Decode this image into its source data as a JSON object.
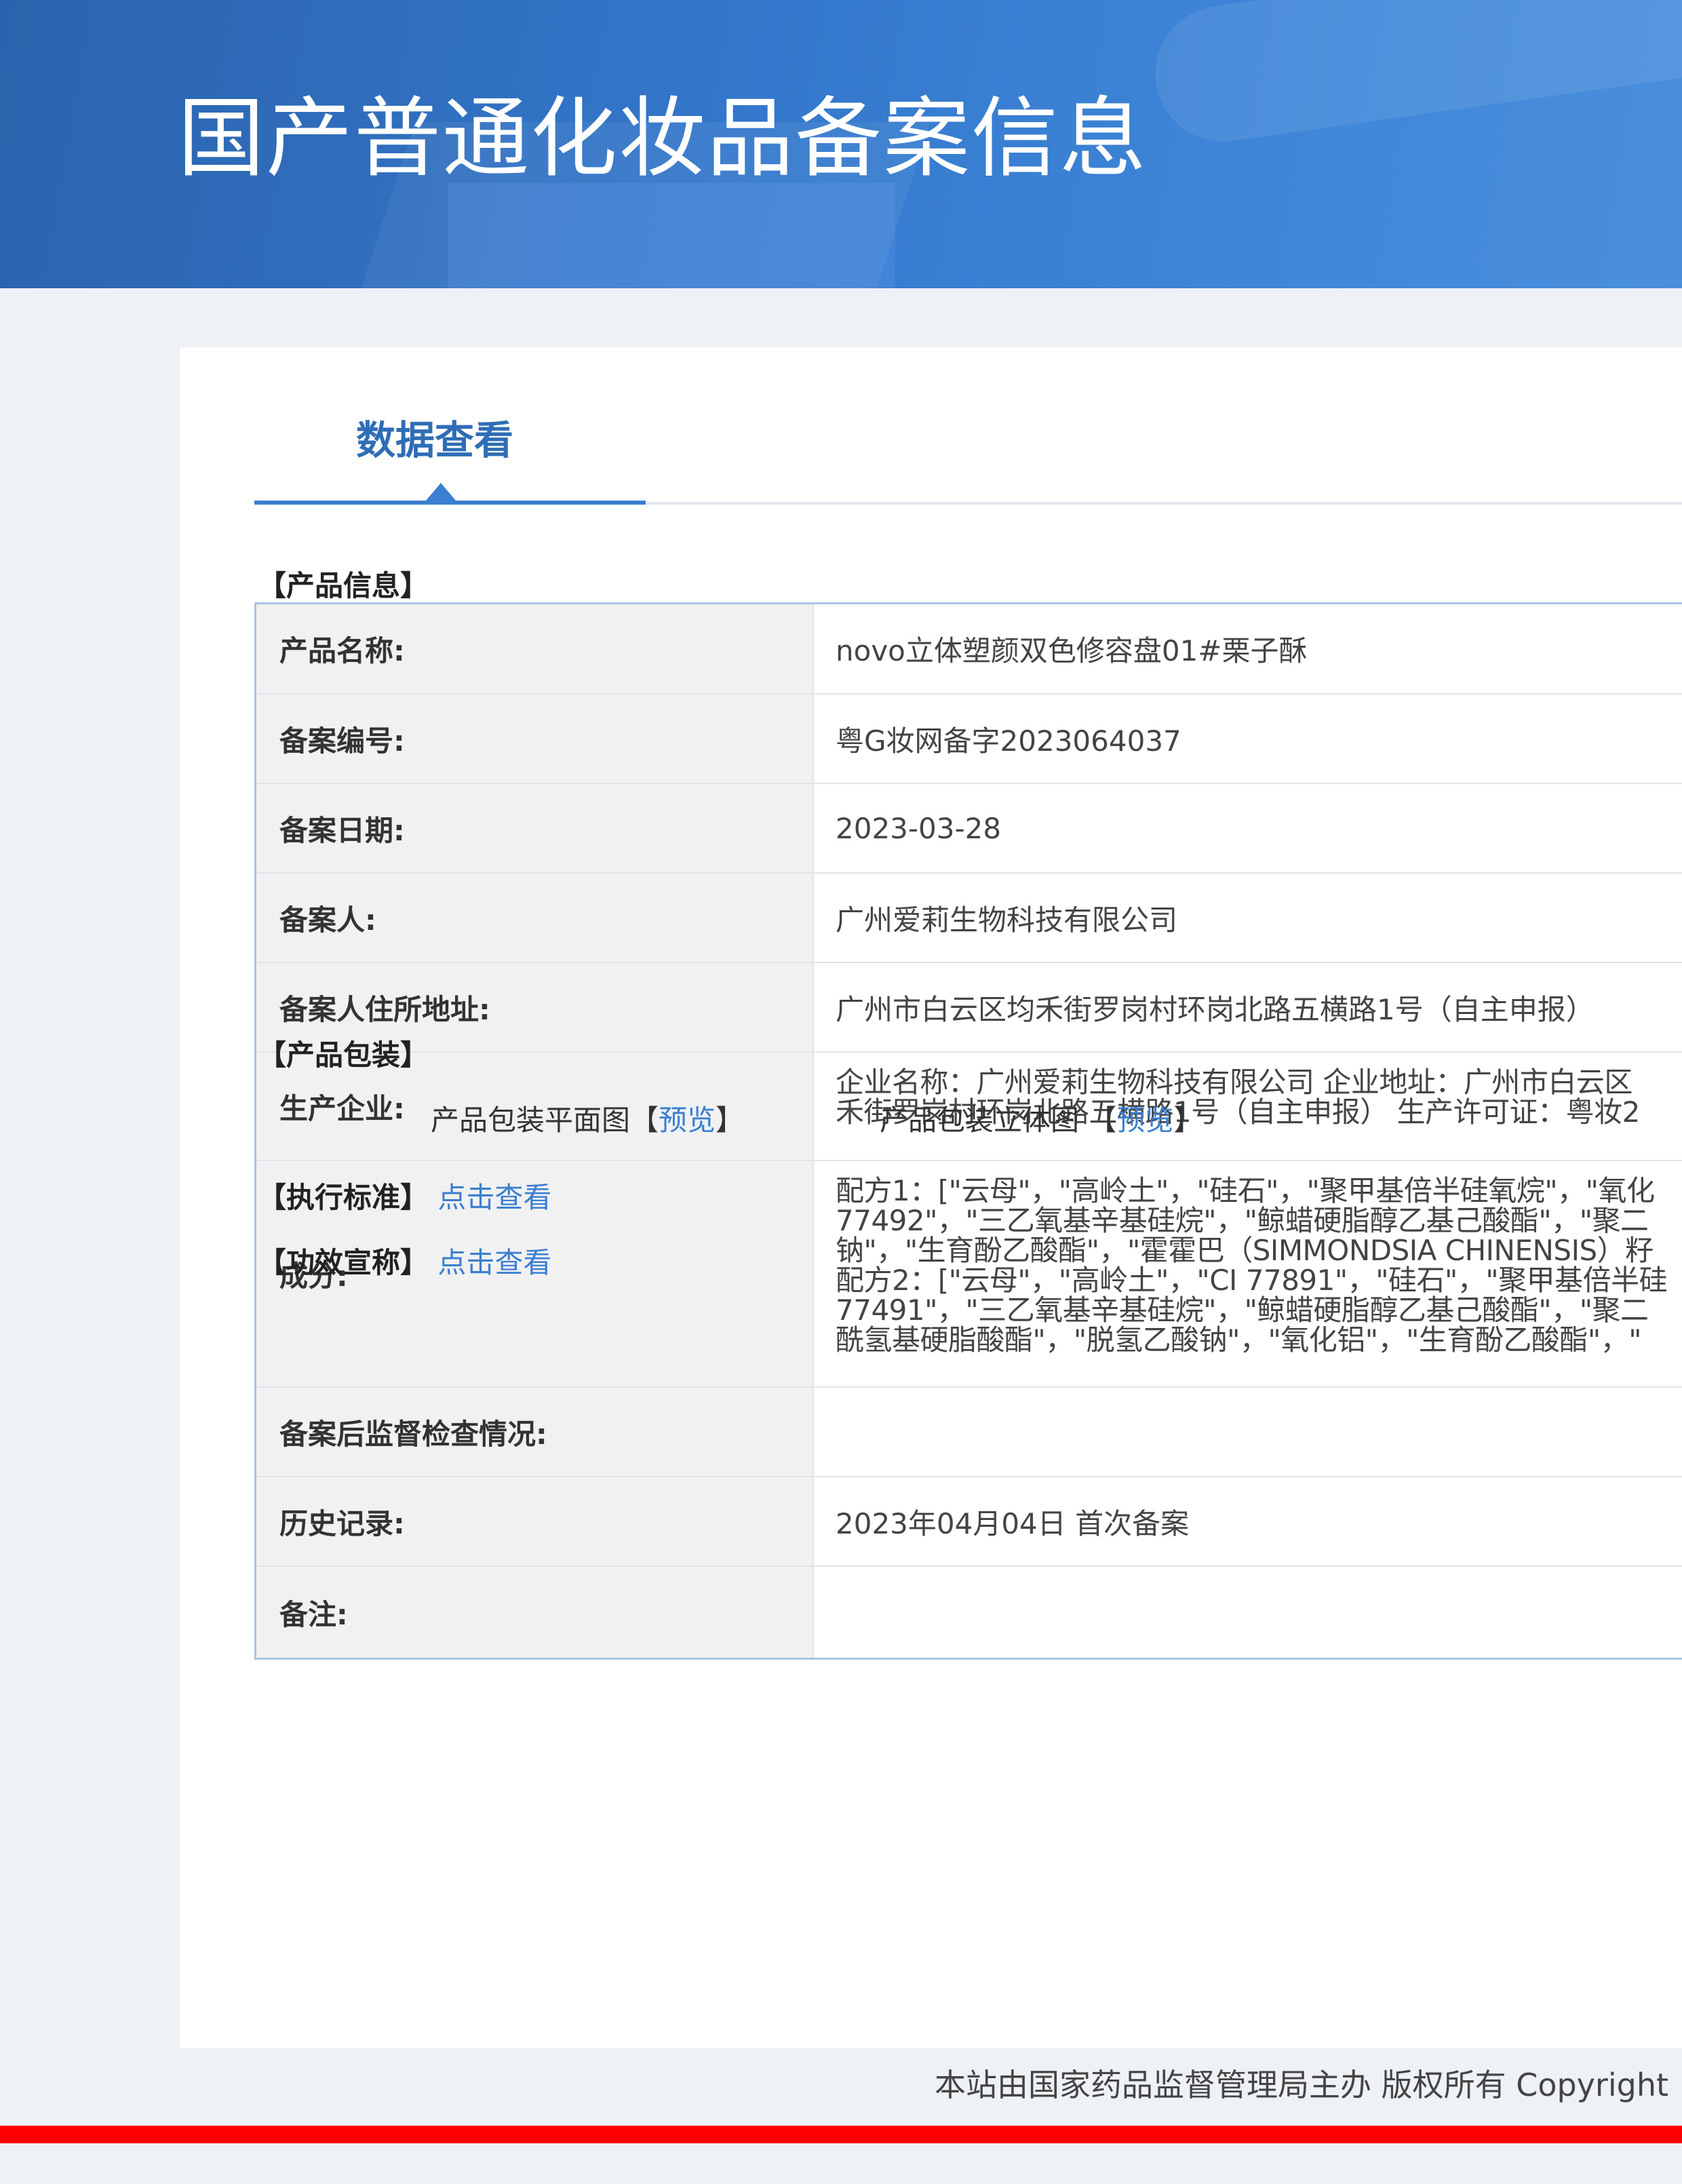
{
  "header": {
    "title": "国产普通化妆品备案信息"
  },
  "tab": {
    "label": "数据查看"
  },
  "sections": {
    "product_info": "【产品信息】",
    "product_package": "【产品包装】"
  },
  "product_table": [
    {
      "label": "产品名称:",
      "value": "novo立体塑颜双色修容盘01#栗子酥"
    },
    {
      "label": "备案编号:",
      "value": "粤G妆网备字2023064037"
    },
    {
      "label": "备案日期:",
      "value": "2023-03-28"
    },
    {
      "label": "备案人:",
      "value": "广州爱莉生物科技有限公司"
    },
    {
      "label": "备案人住所地址:",
      "value": "广州市白云区均禾街罗岗村环岗北路五横路1号（自主申报）"
    },
    {
      "label": "生产企业:",
      "lines": [
        "企业名称：广州爱莉生物科技有限公司 企业地址：广州市白云区",
        "禾街罗岗村环岗北路五横路1号（自主申报） 生产许可证：粤妆2"
      ]
    },
    {
      "label": "成分:",
      "lines": [
        "配方1：[\"云母\"，\"高岭土\"，\"硅石\"，\"聚甲基倍半硅氧烷\"，\"氧化",
        "77492\"，\"三乙氧基辛基硅烷\"，\"鲸蜡硬脂醇乙基己酸酯\"，\"聚二",
        "钠\"，\"生育酚乙酸酯\"，\"霍霍巴（SIMMONDSIA CHINENSIS）籽",
        "配方2：[\"云母\"，\"高岭土\"，\"CI 77891\"，\"硅石\"，\"聚甲基倍半硅",
        "77491\"，\"三乙氧基辛基硅烷\"，\"鲸蜡硬脂醇乙基己酸酯\"，\"聚二",
        "酰氢基硬脂酸酯\"，\"脱氢乙酸钠\"，\"氧化铝\"，\"生育酚乙酸酯\"，\""
      ]
    },
    {
      "label": "备案后监督检查情况:",
      "value": ""
    },
    {
      "label": "历史记录:",
      "value": "2023年04月04日 首次备案"
    },
    {
      "label": "备注:",
      "value": ""
    }
  ],
  "package": {
    "flat_label": "产品包装平面图",
    "solid_label": "产品包装立体图",
    "bracket_open": "【",
    "bracket_close": "】",
    "preview_link": "预览"
  },
  "standard": {
    "label": "【执行标准】",
    "link": "点击查看"
  },
  "efficacy": {
    "label": "【功效宣称】",
    "link": "点击查看"
  },
  "footer": {
    "text": "本站由国家药品监督管理局主办 版权所有 Copyright"
  },
  "colors": {
    "banner": "#3378cc",
    "accent": "#3b7fd1",
    "footer_bar": "#ff0000"
  }
}
